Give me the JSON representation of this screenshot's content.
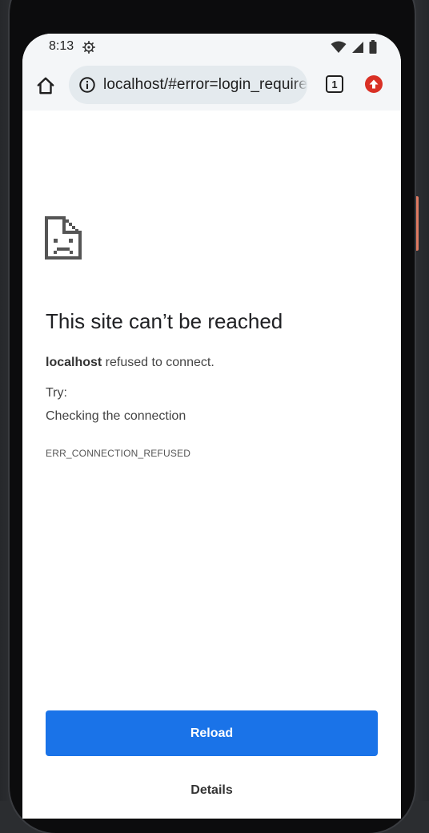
{
  "status_bar": {
    "time": "8:13",
    "icons": [
      "settings-gear-icon",
      "wifi-icon",
      "signal-icon",
      "battery-icon"
    ]
  },
  "toolbar": {
    "home_icon": "home-icon",
    "info_icon": "info-icon",
    "url": "localhost/#error=login_required",
    "tab_count": "1",
    "update_icon": "update-arrow-icon"
  },
  "error_page": {
    "icon": "sad-document-icon",
    "title": "This site can’t be reached",
    "host": "localhost",
    "description_rest": " refused to connect.",
    "try_label": "Try:",
    "suggestion": "Checking the connection",
    "error_code": "ERR_CONNECTION_REFUSED",
    "reload_label": "Reload",
    "details_label": "Details"
  },
  "colors": {
    "reload_button": "#1a73e8",
    "update_badge": "#d93025",
    "toolbar_bg": "#f4f6f8",
    "omnibox_bg": "#e4eaee"
  }
}
